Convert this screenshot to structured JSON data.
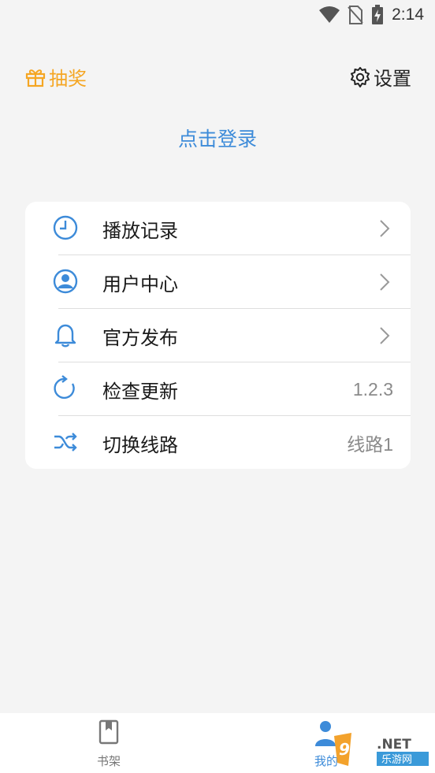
{
  "status_bar": {
    "time": "2:14"
  },
  "header": {
    "lottery_label": "抽奖",
    "settings_label": "设置"
  },
  "login_label": "点击登录",
  "menu": [
    {
      "label": "播放记录",
      "value": ""
    },
    {
      "label": "用户中心",
      "value": ""
    },
    {
      "label": "官方发布",
      "value": ""
    },
    {
      "label": "检查更新",
      "value": "1.2.3"
    },
    {
      "label": "切换线路",
      "value": "线路1"
    }
  ],
  "bottom_nav": {
    "shelf_label": "书架",
    "mine_label": "我的"
  },
  "watermark": {
    "text_top": "962.NET",
    "text_bottom": "乐游网"
  },
  "colors": {
    "accent_blue": "#3d8bd9",
    "accent_orange": "#f5a623",
    "background": "#f4f4f4"
  }
}
